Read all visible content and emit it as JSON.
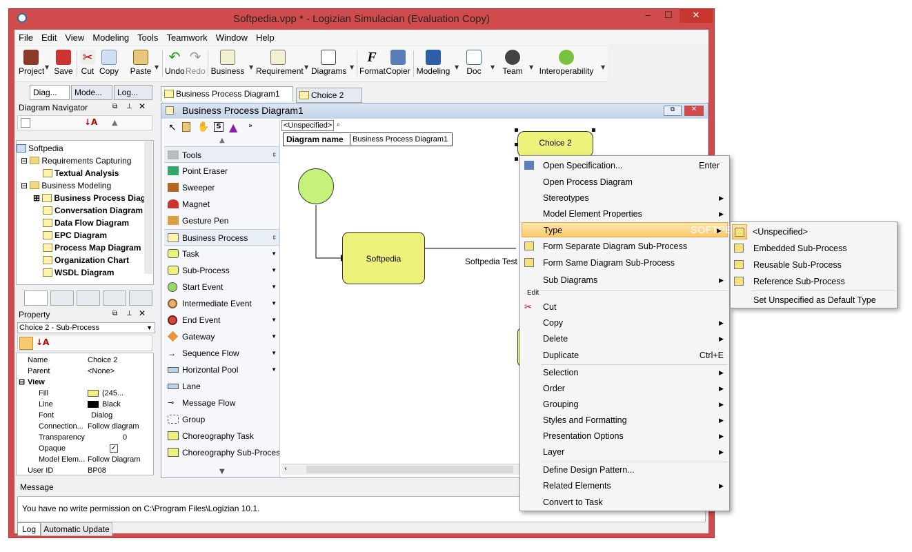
{
  "window": {
    "title": "Softpedia.vpp * - Logizian Simulacian (Evaluation Copy)",
    "minimize": "–",
    "maximize": "☐",
    "close": "✕"
  },
  "menubar": [
    "File",
    "Edit",
    "View",
    "Modeling",
    "Tools",
    "Teamwork",
    "Window",
    "Help"
  ],
  "toolbar": [
    {
      "label": "Project",
      "icon": "project-icon"
    },
    {
      "label": "Save",
      "icon": "save-icon"
    },
    {
      "label": "Cut",
      "icon": "scissors-icon"
    },
    {
      "label": "Copy",
      "icon": "copy-icon"
    },
    {
      "label": "Paste",
      "icon": "paste-icon"
    },
    {
      "label": "Undo",
      "icon": "undo-icon"
    },
    {
      "label": "Redo",
      "icon": "redo-icon"
    },
    {
      "label": "Business",
      "icon": "business-icon"
    },
    {
      "label": "Requirement",
      "icon": "requirement-icon"
    },
    {
      "label": "Diagrams",
      "icon": "diagrams-icon"
    },
    {
      "label": "Format",
      "icon": "format-icon"
    },
    {
      "label": "Copier",
      "icon": "copier-icon"
    },
    {
      "label": "Modeling",
      "icon": "modeling-icon"
    },
    {
      "label": "Doc",
      "icon": "doc-icon"
    },
    {
      "label": "Team",
      "icon": "team-icon"
    },
    {
      "label": "Interoperability",
      "icon": "interoperability-icon"
    }
  ],
  "left_tabs": [
    "Diag...",
    "Mode...",
    "Log..."
  ],
  "navigator": {
    "title": "Diagram Navigator",
    "items": [
      {
        "label": "Softpedia",
        "bold": false
      },
      {
        "label": "Requirements Capturing",
        "bold": false
      },
      {
        "label": "Textual Analysis",
        "bold": true
      },
      {
        "label": "Business Modeling",
        "bold": false
      },
      {
        "label": "Business Process Diag",
        "bold": true
      },
      {
        "label": "Conversation Diagram",
        "bold": true
      },
      {
        "label": "Data Flow Diagram",
        "bold": true
      },
      {
        "label": "EPC Diagram",
        "bold": true
      },
      {
        "label": "Process Map Diagram",
        "bold": true
      },
      {
        "label": "Organization Chart",
        "bold": true
      },
      {
        "label": "WSDL Diagram",
        "bold": true
      }
    ]
  },
  "property": {
    "title": "Property",
    "selected": "Choice 2 - Sub-Process",
    "rows": [
      {
        "key": "Name",
        "value": "Choice 2"
      },
      {
        "key": "Parent",
        "value": "<None>"
      },
      {
        "key": "View",
        "value": ""
      },
      {
        "key": "Fill",
        "value": "(245..."
      },
      {
        "key": "Line",
        "value": "Black"
      },
      {
        "key": "Font",
        "value": "Dialog"
      },
      {
        "key": "Connection...",
        "value": "Follow diagram"
      },
      {
        "key": "Transparency",
        "value": "0"
      },
      {
        "key": "Opaque",
        "value": ""
      },
      {
        "key": "Model Elem...",
        "value": "Follow Diagram"
      },
      {
        "key": "User ID",
        "value": "BP08"
      }
    ]
  },
  "doc_tabs": [
    "Business Process Diagram1",
    "Choice 2"
  ],
  "diagram": {
    "title": "Business Process Diagram1",
    "stereotype": "<Unspecified>",
    "name_label": "Diagram name",
    "name_value": "Business Process Diagram1",
    "task_label": "Softpedia",
    "flow_label": "Softpedia Test",
    "choice_label": "Choice 2"
  },
  "palette": {
    "tools_header": "Tools",
    "tools": [
      "Point Eraser",
      "Sweeper",
      "Magnet",
      "Gesture Pen"
    ],
    "bp_header": "Business Process",
    "bp": [
      "Task",
      "Sub-Process",
      "Start Event",
      "Intermediate Event",
      "End Event",
      "Gateway",
      "Sequence Flow",
      "Horizontal Pool",
      "Lane",
      "Message Flow",
      "Group",
      "Choreography Task",
      "Choreography Sub-Process"
    ]
  },
  "message": {
    "title": "Message",
    "text": "You have no write permission on C:\\Program Files\\Logizian 10.1.",
    "tabs": [
      "Log",
      "Automatic Update"
    ]
  },
  "context_menu": [
    {
      "label": "Open Specification...",
      "shortcut": "Enter",
      "arrow": false
    },
    {
      "label": "Open Process Diagram",
      "shortcut": "",
      "arrow": false
    },
    {
      "label": "Stereotypes",
      "shortcut": "",
      "arrow": true
    },
    {
      "label": "Model Element Properties",
      "shortcut": "",
      "arrow": true
    },
    {
      "label": "Type",
      "shortcut": "",
      "arrow": true
    },
    {
      "label": "Form Separate Diagram Sub-Process",
      "shortcut": "",
      "arrow": false
    },
    {
      "label": "Form Same Diagram Sub-Process",
      "shortcut": "",
      "arrow": false
    },
    {
      "label": "Sub Diagrams",
      "shortcut": "",
      "arrow": true
    },
    {
      "label": "Cut",
      "shortcut": "",
      "arrow": false
    },
    {
      "label": "Copy",
      "shortcut": "",
      "arrow": true
    },
    {
      "label": "Delete",
      "shortcut": "",
      "arrow": true
    },
    {
      "label": "Duplicate",
      "shortcut": "Ctrl+E",
      "arrow": false
    },
    {
      "label": "Selection",
      "shortcut": "",
      "arrow": true
    },
    {
      "label": "Order",
      "shortcut": "",
      "arrow": true
    },
    {
      "label": "Grouping",
      "shortcut": "",
      "arrow": true
    },
    {
      "label": "Styles and Formatting",
      "shortcut": "",
      "arrow": true
    },
    {
      "label": "Presentation Options",
      "shortcut": "",
      "arrow": true
    },
    {
      "label": "Layer",
      "shortcut": "",
      "arrow": true
    },
    {
      "label": "Define Design Pattern...",
      "shortcut": "",
      "arrow": false
    },
    {
      "label": "Related Elements",
      "shortcut": "",
      "arrow": true
    },
    {
      "label": "Convert to Task",
      "shortcut": "",
      "arrow": false
    }
  ],
  "context_section": "Edit",
  "submenu": [
    "<Unspecified>",
    "Embedded Sub-Process",
    "Reusable Sub-Process",
    "Reference Sub-Process",
    "Set Unspecified as Default Type"
  ],
  "watermark": "SOFTPEDIA",
  "colors": {
    "frame": "#d04c4c",
    "task_fill": "#eef27a",
    "start_fill": "#c4f27a",
    "menu_highlight": "#f9c96d"
  }
}
